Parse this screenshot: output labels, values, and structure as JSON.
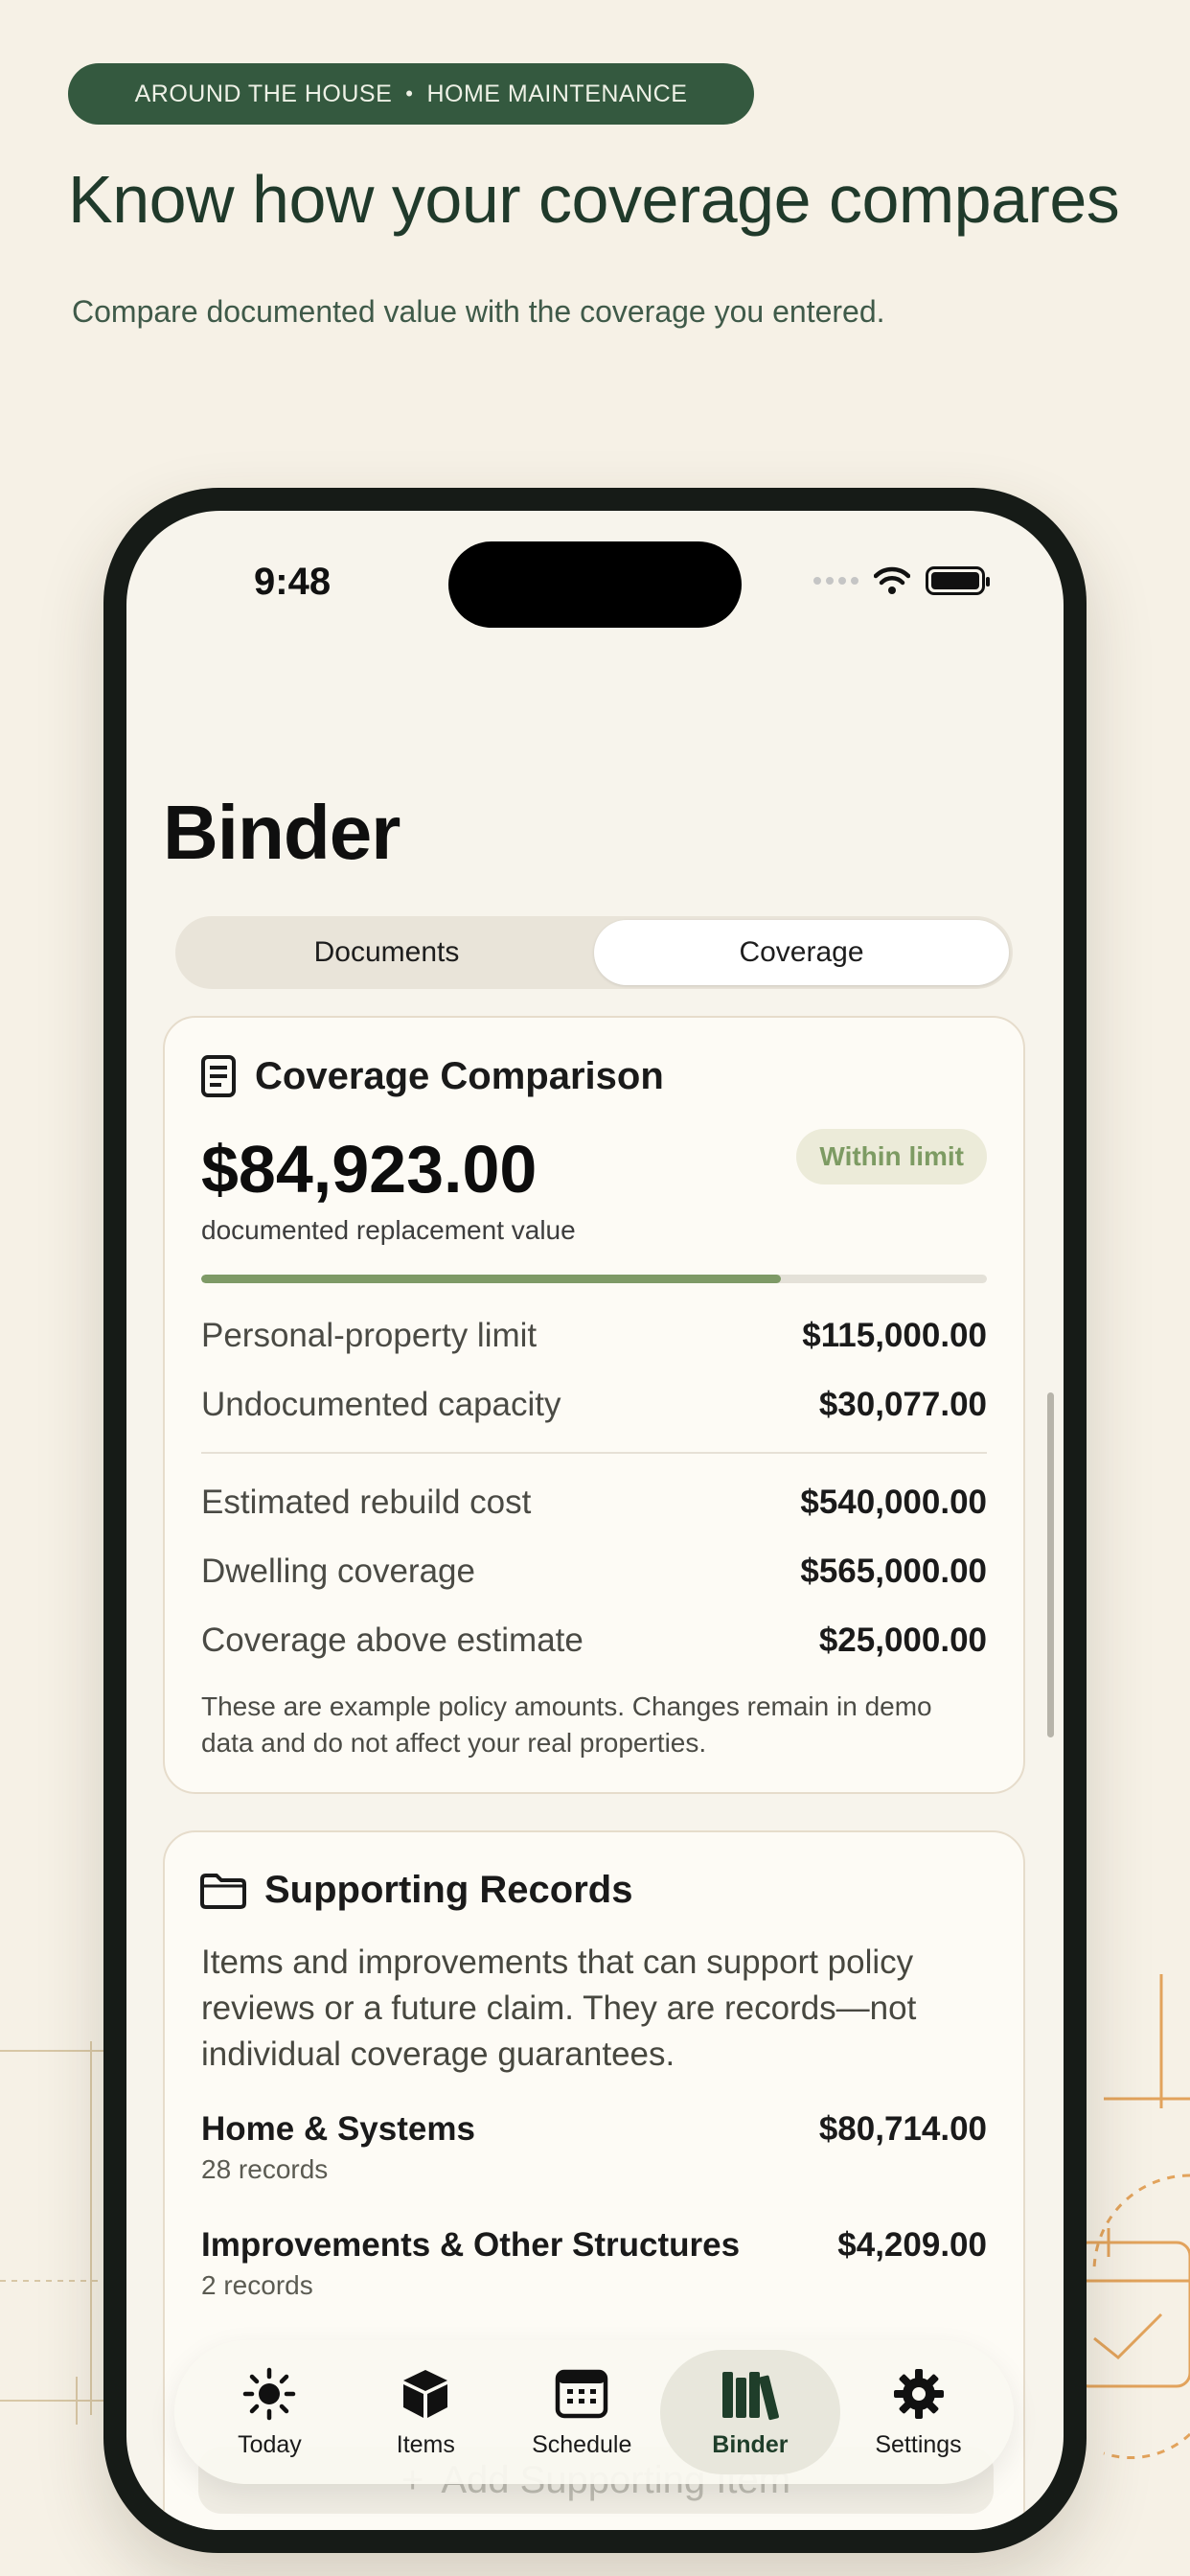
{
  "header": {
    "category_left": "AROUND THE HOUSE",
    "category_sep": "•",
    "category_right": "HOME MAINTENANCE",
    "headline": "Know how your coverage compares",
    "subline": "Compare documented value with the coverage you entered."
  },
  "status_bar": {
    "time": "9:48"
  },
  "screen": {
    "title": "Binder",
    "segments": [
      {
        "label": "Documents",
        "selected": false
      },
      {
        "label": "Coverage",
        "selected": true
      }
    ]
  },
  "coverage_card": {
    "title": "Coverage Comparison",
    "icon": "document-icon",
    "amount": "$84,923.00",
    "amount_caption": "documented replacement value",
    "badge": "Within limit",
    "progress_fraction": 0.738,
    "rows_a": [
      {
        "label": "Personal-property limit",
        "value": "$115,000.00"
      },
      {
        "label": "Undocumented capacity",
        "value": "$30,077.00"
      }
    ],
    "rows_b": [
      {
        "label": "Estimated rebuild cost",
        "value": "$540,000.00"
      },
      {
        "label": "Dwelling coverage",
        "value": "$565,000.00"
      },
      {
        "label": "Coverage above estimate",
        "value": "$25,000.00"
      }
    ],
    "note": "These are example policy amounts. Changes remain in demo data and do not affect your real properties."
  },
  "records_card": {
    "title": "Supporting Records",
    "icon": "folder-icon",
    "description": "Items and improvements that can support policy reviews or a future claim. They are records—not individual coverage guarantees.",
    "records": [
      {
        "name": "Home & Systems",
        "amount": "$80,714.00",
        "count": "28 records"
      },
      {
        "name": "Improvements & Other Structures",
        "amount": "$4,209.00",
        "count": "2 records"
      }
    ],
    "add_button": "Add Supporting Item"
  },
  "tabbar": {
    "tabs": [
      {
        "label": "Today",
        "icon": "sun-icon"
      },
      {
        "label": "Items",
        "icon": "box-icon"
      },
      {
        "label": "Schedule",
        "icon": "calendar-icon"
      },
      {
        "label": "Binder",
        "icon": "books-icon",
        "active": true
      },
      {
        "label": "Settings",
        "icon": "gear-icon"
      }
    ]
  },
  "colors": {
    "brand_green": "#34593f",
    "progress_green": "#7e9a66",
    "background": "#f6f1e6"
  }
}
